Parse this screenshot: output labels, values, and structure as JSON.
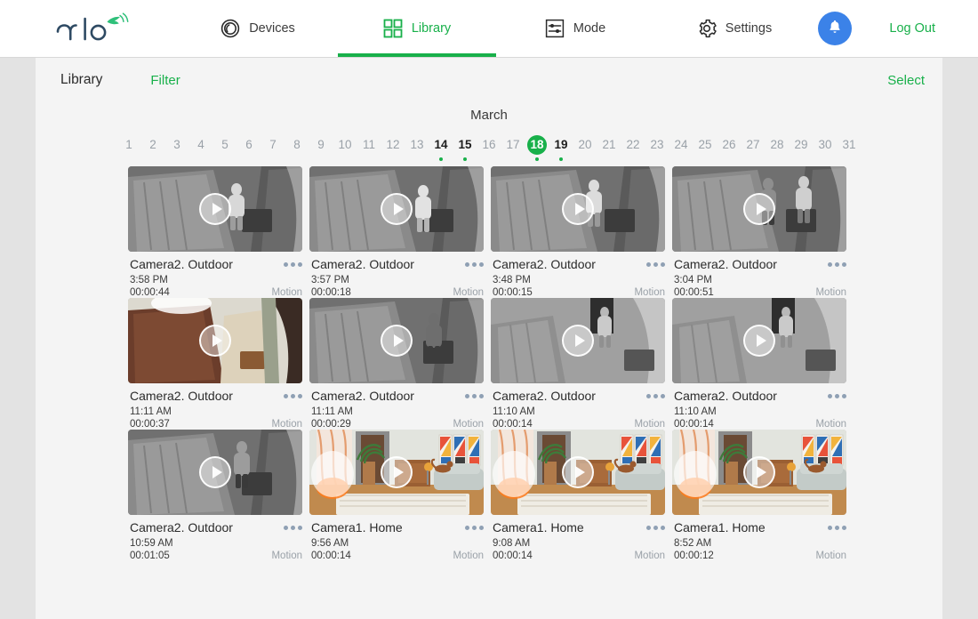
{
  "brand": {
    "name": "arlo",
    "logo_color": "#2e4a63",
    "accent_color": "#18b04a"
  },
  "nav": {
    "items": [
      {
        "label": "Devices",
        "icon": "camera-lens-icon",
        "active": false
      },
      {
        "label": "Library",
        "icon": "grid-squares-icon",
        "active": true
      },
      {
        "label": "Mode",
        "icon": "sliders-icon",
        "active": false
      },
      {
        "label": "Settings",
        "icon": "gear-icon",
        "active": false
      }
    ],
    "notification_icon": "bell-icon",
    "notification_color": "#3b82e8",
    "logout_label": "Log Out"
  },
  "subheader": {
    "title": "Library",
    "filter_label": "Filter",
    "select_label": "Select"
  },
  "calendar": {
    "month": "March",
    "selected_day": 18,
    "days": [
      {
        "n": 1,
        "has": false
      },
      {
        "n": 2,
        "has": false
      },
      {
        "n": 3,
        "has": false
      },
      {
        "n": 4,
        "has": false
      },
      {
        "n": 5,
        "has": false
      },
      {
        "n": 6,
        "has": false
      },
      {
        "n": 7,
        "has": false
      },
      {
        "n": 8,
        "has": false
      },
      {
        "n": 9,
        "has": false
      },
      {
        "n": 10,
        "has": false
      },
      {
        "n": 11,
        "has": false
      },
      {
        "n": 12,
        "has": false
      },
      {
        "n": 13,
        "has": false
      },
      {
        "n": 14,
        "has": true
      },
      {
        "n": 15,
        "has": true
      },
      {
        "n": 16,
        "has": false
      },
      {
        "n": 17,
        "has": false
      },
      {
        "n": 18,
        "has": true
      },
      {
        "n": 19,
        "has": true
      },
      {
        "n": 20,
        "has": false
      },
      {
        "n": 21,
        "has": false
      },
      {
        "n": 22,
        "has": false
      },
      {
        "n": 23,
        "has": false
      },
      {
        "n": 24,
        "has": false
      },
      {
        "n": 25,
        "has": false
      },
      {
        "n": 26,
        "has": false
      },
      {
        "n": 27,
        "has": false
      },
      {
        "n": 28,
        "has": false
      },
      {
        "n": 29,
        "has": false
      },
      {
        "n": 30,
        "has": false
      },
      {
        "n": 31,
        "has": false
      }
    ]
  },
  "recordings": [
    {
      "camera": "Camera2. Outdoor",
      "time": "3:58 PM",
      "duration": "00:00:44",
      "trigger": "Motion",
      "scene": "outdoor-night-person",
      "tint": "gray"
    },
    {
      "camera": "Camera2. Outdoor",
      "time": "3:57 PM",
      "duration": "00:00:18",
      "trigger": "Motion",
      "scene": "outdoor-night-dog",
      "tint": "gray"
    },
    {
      "camera": "Camera2. Outdoor",
      "time": "3:48 PM",
      "duration": "00:00:15",
      "trigger": "Motion",
      "scene": "outdoor-night-person2",
      "tint": "gray"
    },
    {
      "camera": "Camera2. Outdoor",
      "time": "3:04 PM",
      "duration": "00:00:51",
      "trigger": "Motion",
      "scene": "outdoor-night-two-people",
      "tint": "gray"
    },
    {
      "camera": "Camera2. Outdoor",
      "time": "11:11 AM",
      "duration": "00:00:37",
      "trigger": "Motion",
      "scene": "outdoor-day-door",
      "tint": "color"
    },
    {
      "camera": "Camera2. Outdoor",
      "time": "11:11 AM",
      "duration": "00:00:29",
      "trigger": "Motion",
      "scene": "outdoor-day-carry",
      "tint": "gray"
    },
    {
      "camera": "Camera2. Outdoor",
      "time": "11:10 AM",
      "duration": "00:00:14",
      "trigger": "Motion",
      "scene": "outdoor-hall-walk",
      "tint": "gray"
    },
    {
      "camera": "Camera2. Outdoor",
      "time": "11:10 AM",
      "duration": "00:00:14",
      "trigger": "Motion",
      "scene": "outdoor-hall-walk2",
      "tint": "gray"
    },
    {
      "camera": "Camera2. Outdoor",
      "time": "10:59 AM",
      "duration": "00:01:05",
      "trigger": "Motion",
      "scene": "outdoor-hall-person",
      "tint": "gray"
    },
    {
      "camera": "Camera1. Home",
      "time": "9:56 AM",
      "duration": "00:00:14",
      "trigger": "Motion",
      "scene": "living-room-cat",
      "tint": "color"
    },
    {
      "camera": "Camera1. Home",
      "time": "9:08 AM",
      "duration": "00:00:14",
      "trigger": "Motion",
      "scene": "living-room-cat2",
      "tint": "color"
    },
    {
      "camera": "Camera1. Home",
      "time": "8:52 AM",
      "duration": "00:00:12",
      "trigger": "Motion",
      "scene": "living-room-cat3",
      "tint": "color"
    }
  ]
}
